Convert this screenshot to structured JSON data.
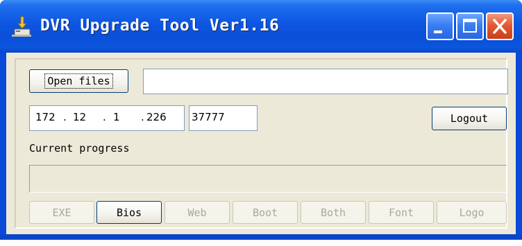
{
  "window": {
    "title": "DVR Upgrade Tool Ver1.16",
    "icon": "app-icon",
    "controls": [
      "minimize-icon",
      "maximize-icon",
      "close-icon"
    ]
  },
  "file": {
    "open_label": "Open files",
    "path_value": ""
  },
  "connection": {
    "ip": [
      "172",
      "12",
      "1",
      "226"
    ],
    "port": "37777",
    "logout_label": "Logout"
  },
  "progress": {
    "label": "Current progress",
    "value": 0
  },
  "upgrade_buttons": [
    {
      "label": "EXE",
      "enabled": false
    },
    {
      "label": "Bios",
      "enabled": true
    },
    {
      "label": "Web",
      "enabled": false
    },
    {
      "label": "Boot",
      "enabled": false
    },
    {
      "label": "Both",
      "enabled": false
    },
    {
      "label": "Font",
      "enabled": false
    },
    {
      "label": "Logo",
      "enabled": false
    }
  ],
  "colors": {
    "titlebar": "#0a4fd7",
    "client": "#ece9d8",
    "button_border": "#003c74",
    "disabled_text": "#aca899"
  }
}
